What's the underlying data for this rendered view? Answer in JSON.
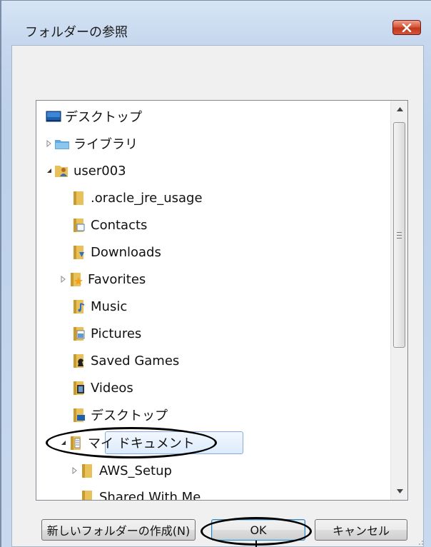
{
  "window": {
    "title": "フォルダーの参照",
    "close_icon": "close-x-icon",
    "close_color": "#d9573c"
  },
  "tree": {
    "items": [
      {
        "label": "デスクトップ",
        "icon": "desktop-icon",
        "expander": "none"
      },
      {
        "label": "ライブラリ",
        "icon": "library-folder-icon",
        "expander": "collapsed"
      },
      {
        "label": "user003",
        "icon": "user-folder-icon",
        "expander": "expanded"
      },
      {
        "label": ".oracle_jre_usage",
        "icon": "folder-icon",
        "expander": "none"
      },
      {
        "label": "Contacts",
        "icon": "contacts-folder-icon",
        "expander": "none"
      },
      {
        "label": "Downloads",
        "icon": "downloads-folder-icon",
        "expander": "none"
      },
      {
        "label": "Favorites",
        "icon": "favorites-folder-icon",
        "expander": "collapsed"
      },
      {
        "label": "Music",
        "icon": "music-folder-icon",
        "expander": "none"
      },
      {
        "label": "Pictures",
        "icon": "pictures-folder-icon",
        "expander": "none"
      },
      {
        "label": "Saved Games",
        "icon": "saved-games-folder-icon",
        "expander": "none"
      },
      {
        "label": "Videos",
        "icon": "videos-folder-icon",
        "expander": "none"
      },
      {
        "label": "デスクトップ",
        "icon": "desktop-folder-icon",
        "expander": "none"
      },
      {
        "label": "マイ ドキュメント",
        "icon": "documents-folder-icon",
        "expander": "expanded",
        "selected": true
      },
      {
        "label": "AWS_Setup",
        "icon": "folder-icon",
        "expander": "collapsed"
      },
      {
        "label": "Shared With Me",
        "icon": "folder-icon",
        "expander": "none"
      }
    ]
  },
  "buttons": {
    "new_folder": "新しいフォルダーの作成(N)",
    "ok": "OK",
    "cancel": "キャンセル"
  },
  "colors": {
    "selection": "#dcebfc",
    "selection_border": "#84acdd",
    "folder": "#e8c15a",
    "annotation": "#000000"
  }
}
